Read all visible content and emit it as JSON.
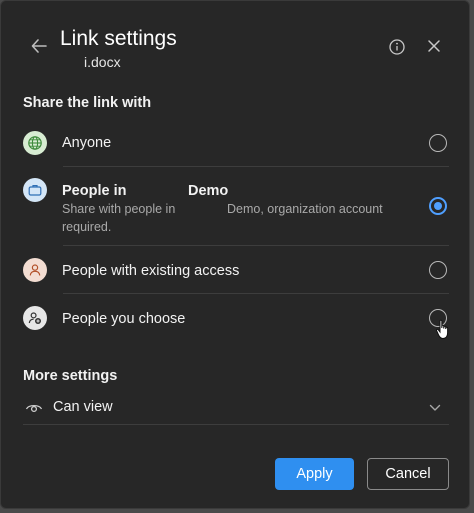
{
  "header": {
    "title": "Link settings",
    "filename": "i.docx",
    "back_icon": "arrow-left-icon",
    "info_icon": "info-icon",
    "close_icon": "close-icon"
  },
  "share_section": {
    "label": "Share the link with",
    "options": [
      {
        "label": "Anyone",
        "icon": "globe-icon",
        "selected": false
      },
      {
        "label": "People in",
        "label_suffix": "Demo",
        "description_part1": "Share with people in",
        "description_part2": "Demo, organization account",
        "description_part3": "required.",
        "icon": "briefcase-icon",
        "selected": true
      },
      {
        "label": "People with existing access",
        "icon": "person-icon",
        "selected": false
      },
      {
        "label": "People you choose",
        "icon": "person-add-icon",
        "selected": false
      }
    ]
  },
  "more_settings": {
    "label": "More settings",
    "permission": {
      "label": "Can view",
      "icon": "eye-icon",
      "chevron": "chevron-down-icon"
    }
  },
  "footer": {
    "apply_label": "Apply",
    "cancel_label": "Cancel"
  },
  "colors": {
    "dialog_bg": "#272727",
    "accent": "#2f8ff0",
    "radio_selected": "#4f9fff",
    "divider": "#3d3d3d"
  }
}
